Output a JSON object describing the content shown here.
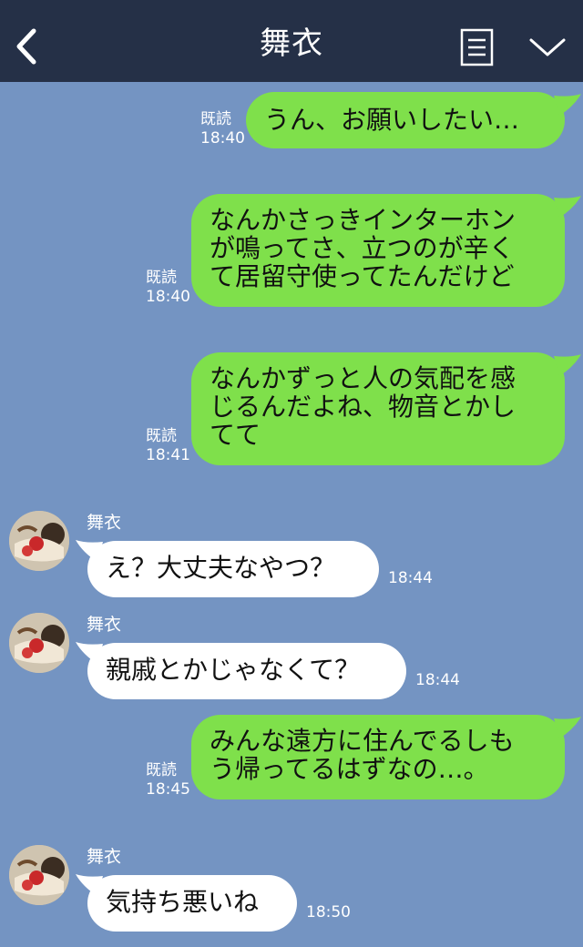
{
  "header": {
    "title": "舞衣",
    "back_icon": "chevron-left-icon",
    "notes_icon": "notes-icon",
    "menu_icon": "chevron-down-icon"
  },
  "colors": {
    "header_bg": "#253047",
    "chat_bg": "#7494c2",
    "outgoing_bubble": "#7fe04b",
    "incoming_bubble": "#ffffff"
  },
  "messages": [
    {
      "direction": "out",
      "read": "既読",
      "time": "18:40",
      "lines": [
        "うん、お願いしたい…"
      ]
    },
    {
      "direction": "out",
      "read": "既読",
      "time": "18:40",
      "lines": [
        "なんかさっきインターホン",
        "が鳴ってさ、立つのが辛く",
        "て居留守使ってたんだけど"
      ]
    },
    {
      "direction": "out",
      "read": "既読",
      "time": "18:41",
      "lines": [
        "なんかずっと人の気配を感",
        "じるんだよね、物音とかし",
        "てて"
      ]
    },
    {
      "direction": "in",
      "sender": "舞衣",
      "time": "18:44",
      "lines": [
        "え？大丈夫なやつ？"
      ]
    },
    {
      "direction": "in",
      "sender": "舞衣",
      "time": "18:44",
      "lines": [
        "親戚とかじゃなくて？"
      ]
    },
    {
      "direction": "out",
      "read": "既読",
      "time": "18:45",
      "lines": [
        "みんな遠方に住んでるしも",
        "う帰ってるはずなの…。"
      ]
    },
    {
      "direction": "in",
      "sender": "舞衣",
      "time": "18:50",
      "lines": [
        "気持ち悪いね"
      ]
    }
  ]
}
